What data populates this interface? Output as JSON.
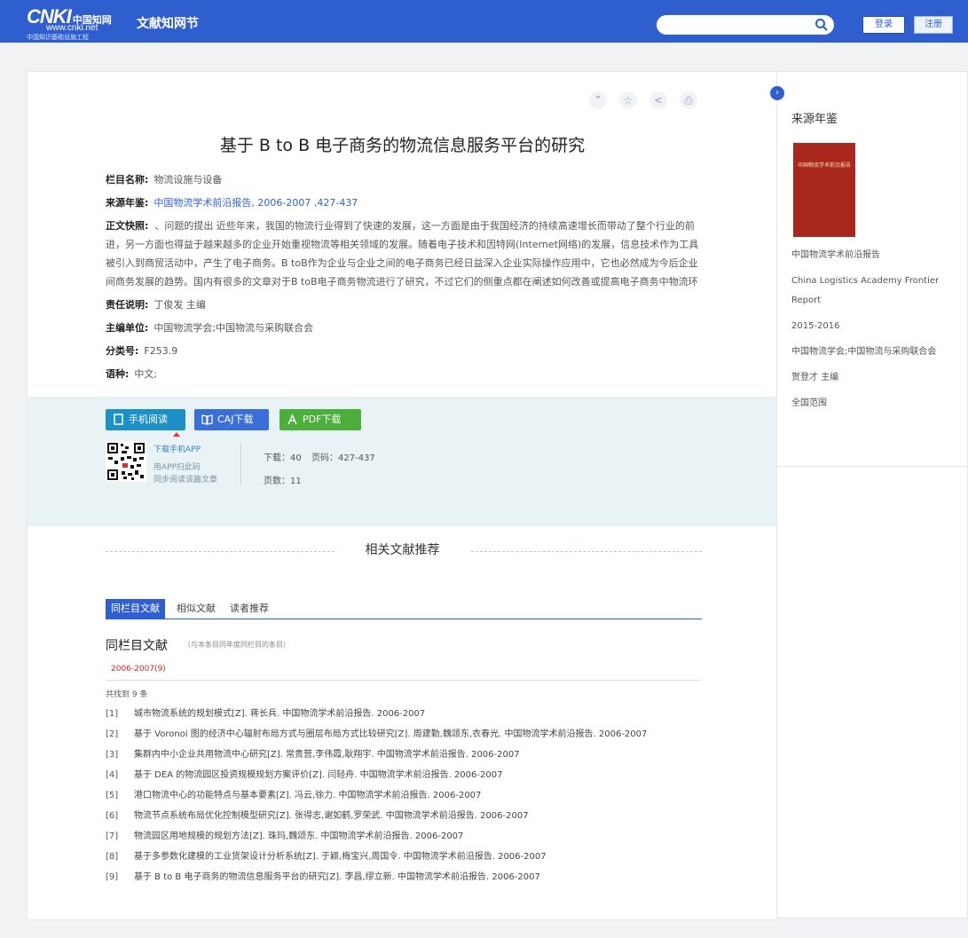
{
  "header": {
    "logo_brand": "CNKI",
    "logo_cn": "中国知网",
    "logo_url": "www.cnki.net",
    "logo_sub": "中国知识基础设施工程",
    "site_name": "文献知网节",
    "search_placeholder": "",
    "login_label": "登录",
    "register_label": "注册"
  },
  "article": {
    "title": "基于 B to B 电子商务的物流信息服务平台的研究",
    "fields": [
      {
        "label": "栏目名称:",
        "value": "物流设施与设备"
      },
      {
        "label": "来源年鉴:",
        "value": "中国物流学术前沿报告, 2006-2007 ,427-437"
      }
    ],
    "abstract_label": "正文快照:",
    "abstract_text": "、问题的提出 近些年来，我国的物流行业得到了快速的发展，这一方面是由于我国经济的持续高速增长而带动了整个行业的前进，另一方面也得益于越来越多的企业开始重视物流等相关领域的发展。随着电子技术和因特网(Internet网络)的发展，信息技术作为工具被引入到商贸活动中，产生了电子商务。B toB作为企业与企业之间的电子商务已经日益深入企业实际操作应用中，它也必然成为今后企业间商务发展的趋势。国内有很多的文章对于B toB电子商务物流进行了研究，不过它们的侧重点都在阐述如何改善或提高电子商务中物流环",
    "more_fields": [
      {
        "label": "责任说明:",
        "value": "丁俊发 主编"
      },
      {
        "label": "主编单位:",
        "value": "中国物流学会;中国物流与采购联合会"
      },
      {
        "label": "分类号:",
        "value": "F253.9"
      },
      {
        "label": "语种:",
        "value": "中文;"
      }
    ]
  },
  "downloads": {
    "mobile_label": "手机阅读",
    "caj_label": "CAJ下载",
    "pdf_label": "PDF下载",
    "qr_line1": "下载手机APP",
    "qr_line2": "用APP扫此码",
    "qr_line3": "同步阅读该篇文章",
    "downloads_text": "下载：40",
    "pages_text": "页码：427-437",
    "page_count_text": "页数：11"
  },
  "recommend": {
    "title": "相关文献推荐",
    "tabs": [
      "同栏目文献",
      "相似文献",
      "读者推荐"
    ],
    "section_title": "同栏目文献",
    "section_note": "（与本条目同年度同栏目的条目）",
    "year": "2006-2007(9)",
    "count": "共找到 9 条",
    "refs": [
      {
        "num": "[1]",
        "text": "城市物流系统的规划模式[Z]. 蒋长兵. 中国物流学术前沿报告. 2006-2007"
      },
      {
        "num": "[2]",
        "text": "基于 Voronoi 图的经济中心辐射布局方式与圈层布局方式比较研究[Z]. 周建勤,魏颂东,衣春光. 中国物流学术前沿报告. 2006-2007"
      },
      {
        "num": "[3]",
        "text": "集群内中小企业共用物流中心研究[Z]. 常贵营,李伟霞,耿翔宇. 中国物流学术前沿报告. 2006-2007"
      },
      {
        "num": "[4]",
        "text": "基于 DEA 的物流园区投资规模规划方案评价[Z]. 闫轻舟. 中国物流学术前沿报告. 2006-2007"
      },
      {
        "num": "[5]",
        "text": "港口物流中心的功能特点与基本要素[Z]. 冯云,徐力. 中国物流学术前沿报告. 2006-2007"
      },
      {
        "num": "[6]",
        "text": "物流节点系统布局优化控制模型研究[Z]. 张得志,谢如鹤,罗荣武. 中国物流学术前沿报告. 2006-2007"
      },
      {
        "num": "[7]",
        "text": "物流园区用地规模的规划方法[Z]. 珠玛,魏颂东. 中国物流学术前沿报告. 2006-2007"
      },
      {
        "num": "[8]",
        "text": "基于多参数化建模的工业货架设计分析系统[Z]. 于颖,梅宝兴,周国令. 中国物流学术前沿报告. 2006-2007"
      },
      {
        "num": "[9]",
        "text": "基于 B to B 电子商务的物流信息服务平台的研究[Z]. 李昌,缪立新. 中国物流学术前沿报告. 2006-2007"
      }
    ]
  },
  "sidebar": {
    "title": "来源年鉴",
    "cover_text": "中国物流学术前沿报告",
    "items": [
      "中国物流学术前沿报告",
      "China Logistics Academy Frontier Report",
      "2015-2016",
      "中国物流学会;中国物流与采购联合会",
      "贺登才 主编",
      "全国范围"
    ]
  },
  "colors": {
    "brand": "#2f5fcf",
    "caj": "#3a6fd8",
    "mobile": "#1e90c8",
    "pdf": "#4caf3c",
    "year": "#cc2a2a"
  }
}
